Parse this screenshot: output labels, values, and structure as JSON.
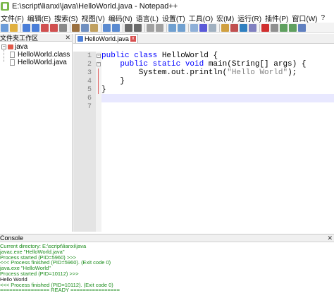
{
  "window": {
    "title": "E:\\script\\lianxi\\java\\HelloWorld.java - Notepad++"
  },
  "menubar": {
    "items": [
      "文件(F)",
      "编辑(E)",
      "搜索(S)",
      "视图(V)",
      "编码(N)",
      "语言(L)",
      "设置(T)",
      "工具(O)",
      "宏(M)",
      "运行(R)",
      "插件(P)",
      "窗口(W)",
      "?"
    ]
  },
  "toolbar": {
    "buttons": [
      "new-icon",
      "open-icon",
      "save-icon",
      "save-all-icon",
      "close-icon",
      "close-all-icon",
      "print-icon",
      "cut-icon",
      "copy-icon",
      "paste-icon",
      "undo-icon",
      "redo-icon",
      "find-icon",
      "replace-icon",
      "zoom-in-icon",
      "zoom-out-icon",
      "sync-v-icon",
      "sync-h-icon",
      "wrap-icon",
      "all-chars-icon",
      "indent-guide-icon",
      "doc-map-icon",
      "function-list-icon",
      "folder-workspace-icon",
      "monitor-icon",
      "record-icon",
      "stop-icon",
      "play-icon",
      "play-multi-icon",
      "save-macro-icon"
    ]
  },
  "sidebar": {
    "title": "文件夹工作区",
    "close": "✕",
    "root": {
      "label": "java",
      "expander": "−"
    },
    "children": [
      "HelloWorld.class",
      "HelloWorld.java"
    ]
  },
  "editor": {
    "tab_label": "HelloWorld.java",
    "tab_close": "x",
    "lines": [
      {
        "num": "1",
        "segments": [
          [
            "kw",
            "public class "
          ],
          [
            "plain",
            "HelloWorld "
          ],
          [
            "brace",
            "{"
          ]
        ]
      },
      {
        "num": "2",
        "segments": [
          [
            "plain",
            "    "
          ],
          [
            "kw",
            "public static void "
          ],
          [
            "plain",
            "main(String[] args) {"
          ]
        ]
      },
      {
        "num": "3",
        "segments": [
          [
            "plain",
            "        System.out.println("
          ],
          [
            "str",
            "\"Hello World\""
          ],
          [
            "plain",
            ");"
          ]
        ]
      },
      {
        "num": "4",
        "segments": [
          [
            "plain",
            "    }"
          ]
        ]
      },
      {
        "num": "5",
        "segments": [
          [
            "plain",
            "}"
          ]
        ]
      },
      {
        "num": "6",
        "segments": [
          [
            "plain",
            ""
          ]
        ]
      },
      {
        "num": "7",
        "segments": [
          [
            "plain",
            ""
          ]
        ]
      }
    ]
  },
  "console": {
    "title": "Console",
    "close": "✕",
    "lines": [
      {
        "style": "green",
        "text": "Current directory: E:\\script\\lianxi\\java"
      },
      {
        "style": "green",
        "text": "javac.exe \"HelloWorld.java\""
      },
      {
        "style": "green",
        "text": "Process started (PID=5960) >>>"
      },
      {
        "style": "green",
        "text": "<<< Process finished (PID=5960). (Exit code 0)"
      },
      {
        "style": "green",
        "text": "java.exe \"HelloWorld\""
      },
      {
        "style": "green",
        "text": "Process started (PID=10112) >>>"
      },
      {
        "style": "black",
        "text": "Hello World"
      },
      {
        "style": "green",
        "text": "<<< Process finished (PID=10112). (Exit code 0)"
      },
      {
        "style": "green",
        "text": "================ READY ================"
      }
    ]
  },
  "colors": {
    "keyword": "#0000ff",
    "string": "#808080",
    "console_green": "#1a8c1a",
    "current_line": "#e8e8ff"
  }
}
